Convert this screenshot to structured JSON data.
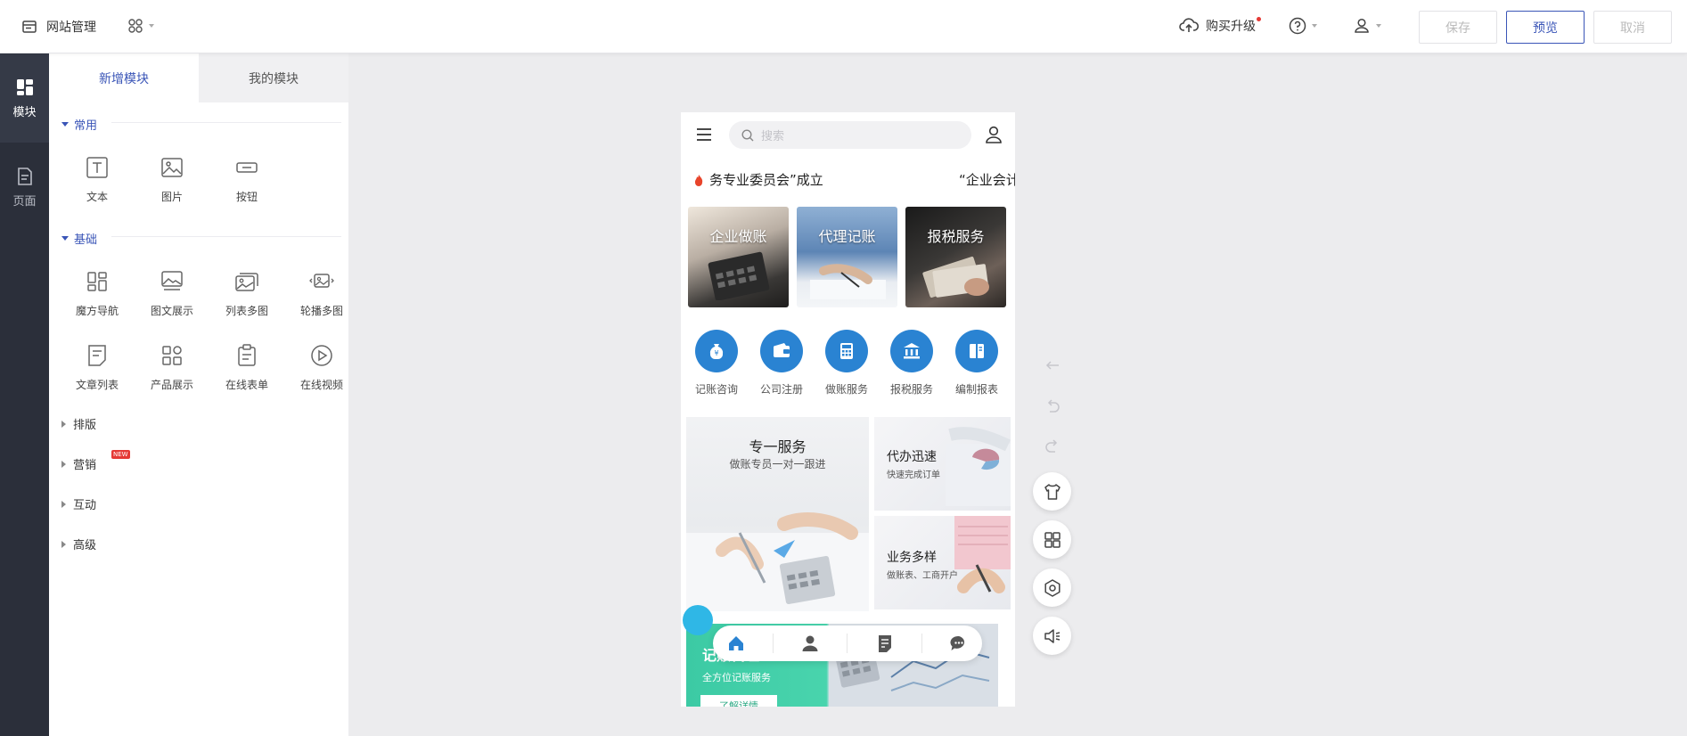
{
  "topbar": {
    "site_manage_label": "网站管理",
    "upgrade_label": "购买升级",
    "save_label": "保存",
    "preview_label": "预览",
    "cancel_label": "取消"
  },
  "rail": {
    "items": [
      {
        "label": "模块",
        "icon": "modules-icon",
        "active": true
      },
      {
        "label": "页面",
        "icon": "page-icon",
        "active": false
      }
    ]
  },
  "panel": {
    "tabs": [
      "新增模块",
      "我的模块"
    ],
    "sections": {
      "common": {
        "title": "常用",
        "items": [
          "文本",
          "图片",
          "按钮"
        ]
      },
      "basic": {
        "title": "基础",
        "items": [
          "魔方导航",
          "图文展示",
          "列表多图",
          "轮播多图",
          "文章列表",
          "产品展示",
          "在线表单",
          "在线视频"
        ]
      },
      "collapsed": [
        "排版",
        "营销",
        "互动",
        "高级"
      ],
      "new_badge": "NEW"
    }
  },
  "phone": {
    "search_placeholder": "搜索",
    "news_1": "务专业委员会”成立",
    "news_2": "“企业会计",
    "tiles": [
      "企业做账",
      "代理记账",
      "报税服务"
    ],
    "services": [
      "记账咨询",
      "公司注册",
      "做账服务",
      "报税服务",
      "编制报表"
    ],
    "feature_big": {
      "title": "专一服务",
      "subtitle": "做账专员一对一跟进"
    },
    "feature_small": [
      {
        "title": "代办迅速",
        "subtitle": "快速完成订单"
      },
      {
        "title": "业务多样",
        "subtitle": "做账表、工商开户"
      }
    ],
    "banner": {
      "title": "记账代理",
      "subtitle": "全方位记账服务",
      "button": "了解详情"
    }
  },
  "colors": {
    "accent": "#3a55b7",
    "service_blue": "#2a83d2",
    "rail_bg": "#2b2f3a",
    "banner_green": "#3ccaa4"
  }
}
